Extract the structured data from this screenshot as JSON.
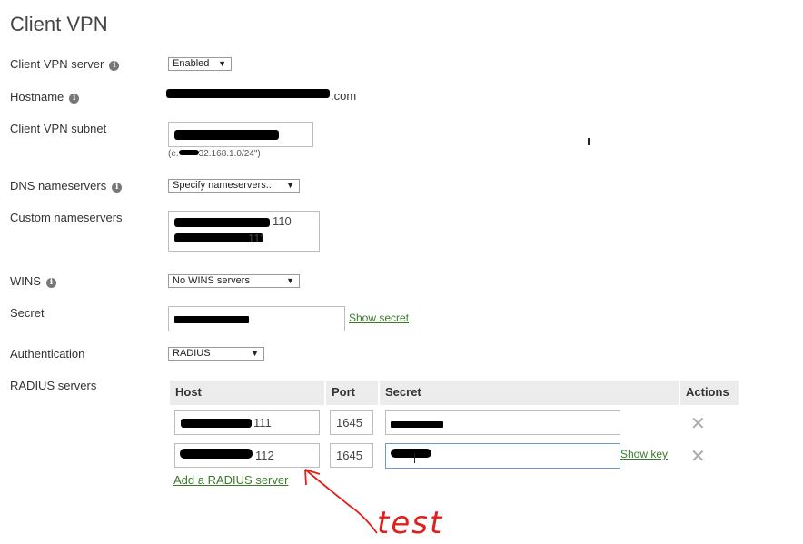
{
  "page": {
    "title": "Client VPN"
  },
  "fields": {
    "server_label": "Client VPN server",
    "server_value": "Enabled",
    "hostname_label": "Hostname",
    "hostname_suffix": ".com",
    "subnet_label": "Client VPN subnet",
    "subnet_hint_prefix": "(e.",
    "subnet_hint_suffix": "32.168.1.0/24\")",
    "dns_label": "DNS nameservers",
    "dns_value": "Specify nameservers...",
    "custom_ns_label": "Custom nameservers",
    "custom_ns_line1_suffix": "110",
    "custom_ns_line2_suffix": "111",
    "wins_label": "WINS",
    "wins_value": "No WINS servers",
    "secret_label": "Secret",
    "show_secret": "Show secret",
    "auth_label": "Authentication",
    "auth_value": "RADIUS",
    "radius_label": "RADIUS servers"
  },
  "radius": {
    "headers": {
      "host": "Host",
      "port": "Port",
      "secret": "Secret",
      "actions": "Actions"
    },
    "rows": [
      {
        "host_suffix": "111",
        "port": "1645"
      },
      {
        "host_suffix": "112",
        "port": "1645"
      }
    ],
    "show_key": "Show key",
    "add_link": "Add a RADIUS server",
    "remove_icon": "close-icon"
  },
  "annotation": {
    "text": "test",
    "color": "#e0201b"
  }
}
